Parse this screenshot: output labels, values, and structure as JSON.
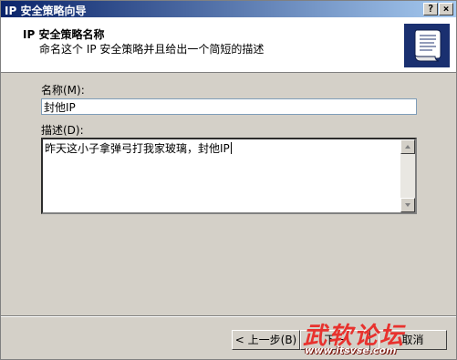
{
  "window": {
    "title": "IP 安全策略向导",
    "help_button": "?",
    "close_button": "×"
  },
  "header": {
    "title": "IP 安全策略名称",
    "subtitle": "命名这个 IP 安全策略并且给出一个简短的描述",
    "icon": "scroll-document-icon"
  },
  "form": {
    "name_label": "名称(M):",
    "name_value": "封他IP",
    "description_label": "描述(D):",
    "description_value": "昨天这小子拿弹弓打我家玻璃，封他IP"
  },
  "buttons": {
    "back": "< 上一步(B)",
    "next": "下一",
    "cancel": "取消"
  },
  "watermark": {
    "text": "武软论坛",
    "url": "www.itsvse.com"
  },
  "colors": {
    "titlebar_start": "#0a246a",
    "titlebar_end": "#a6caf0",
    "dialog_face": "#d4d0c8",
    "watermark_red": "#e8322e"
  }
}
